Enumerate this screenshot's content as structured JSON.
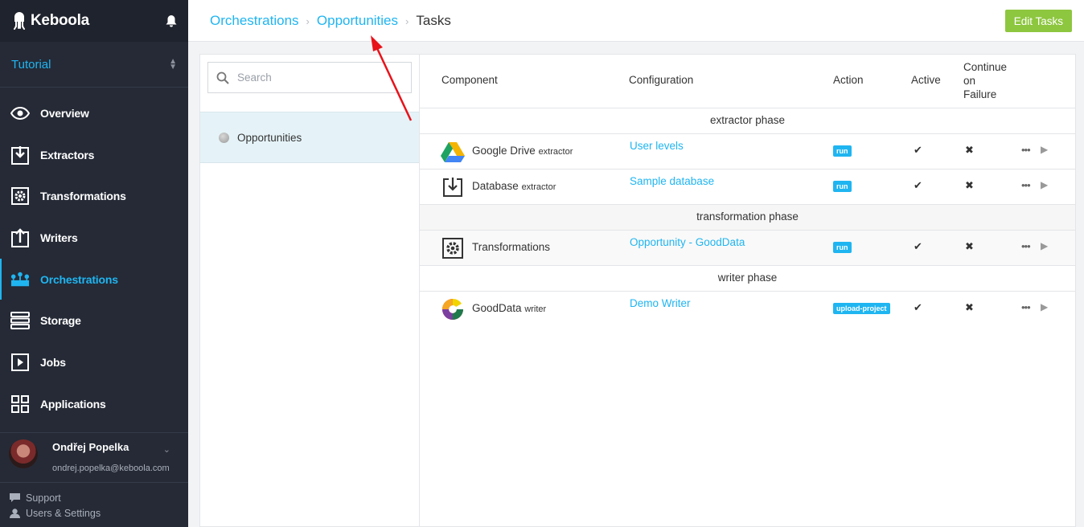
{
  "brand": {
    "name": "Keboola",
    "icon": "keboola-logo-icon",
    "notifications_icon": "bell-icon"
  },
  "project": {
    "name": "Tutorial",
    "switch_icon": "chevron-updown-icon"
  },
  "nav": {
    "items": [
      {
        "label": "Overview",
        "icon": "eye-icon"
      },
      {
        "label": "Extractors",
        "icon": "extract-icon"
      },
      {
        "label": "Transformations",
        "icon": "cog-icon"
      },
      {
        "label": "Writers",
        "icon": "upload-icon"
      },
      {
        "label": "Orchestrations",
        "icon": "orchestration-icon",
        "active": true
      },
      {
        "label": "Storage",
        "icon": "storage-icon"
      },
      {
        "label": "Jobs",
        "icon": "play-box-icon"
      },
      {
        "label": "Applications",
        "icon": "grid-icon"
      }
    ]
  },
  "user": {
    "name": "Ondřej Popelka",
    "email": "ondrej.popelka@keboola.com"
  },
  "footer": {
    "support": "Support",
    "settings": "Users & Settings"
  },
  "breadcrumb": {
    "level1": "Orchestrations",
    "level2": "Opportunities",
    "current": "Tasks"
  },
  "header": {
    "edit_label": "Edit Tasks"
  },
  "left": {
    "search_placeholder": "Search",
    "orchestration": "Opportunities"
  },
  "table": {
    "columns": {
      "component": "Component",
      "configuration": "Configuration",
      "action": "Action",
      "active": "Active",
      "continue_l1": "Continue",
      "continue_l2": "on",
      "continue_l3": "Failure"
    },
    "phases": [
      {
        "name": "extractor phase",
        "tasks": [
          {
            "component": "Google Drive",
            "type": "extractor",
            "icon": "google-drive-icon",
            "configuration": "User levels",
            "action": "run"
          },
          {
            "component": "Database",
            "type": "extractor",
            "icon": "database-extract-icon",
            "configuration": "Sample database",
            "action": "run"
          }
        ]
      },
      {
        "name": "transformation phase",
        "tasks": [
          {
            "component": "Transformations",
            "type": "",
            "icon": "transformation-cog-icon",
            "configuration": "Opportunity - GoodData",
            "action": "run"
          }
        ]
      },
      {
        "name": "writer phase",
        "tasks": [
          {
            "component": "GoodData",
            "type": "writer",
            "icon": "gooddata-icon",
            "configuration": "Demo Writer",
            "action": "upload-project"
          }
        ]
      }
    ],
    "active_mark": "✔",
    "failure_mark": "✖",
    "more_glyph": "•••",
    "run_glyph": "▶"
  },
  "colors": {
    "accent": "#1fb5f1",
    "sidebar": "#252a36",
    "edit_button": "#8dc63f",
    "annotation_arrow": "#e8121a"
  }
}
